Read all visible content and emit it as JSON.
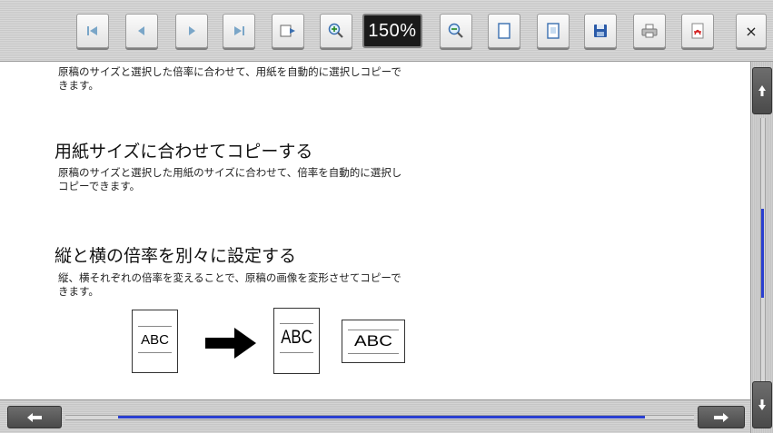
{
  "toolbar": {
    "buttons": [
      {
        "name": "first-page-button",
        "icon": "first-page-icon"
      },
      {
        "name": "previous-page-button",
        "icon": "previous-page-icon"
      },
      {
        "name": "next-page-button",
        "icon": "next-page-icon"
      },
      {
        "name": "last-page-button",
        "icon": "last-page-icon"
      },
      {
        "name": "page-jump-button",
        "icon": "page-arrow-icon"
      },
      {
        "name": "zoom-in-button",
        "icon": "zoom-in-icon"
      },
      {
        "name": "zoom-out-button",
        "icon": "zoom-out-icon"
      },
      {
        "name": "fit-page-button",
        "icon": "page-icon"
      },
      {
        "name": "page-view-button",
        "icon": "document-icon"
      },
      {
        "name": "save-button",
        "icon": "floppy-disk-icon"
      },
      {
        "name": "print-button",
        "icon": "printer-icon"
      },
      {
        "name": "pdf-button",
        "icon": "pdf-icon"
      }
    ],
    "zoom_level": "150%",
    "close_label": "×"
  },
  "content": {
    "intro_text_line1": "原稿のサイズと選択した倍率に合わせて、用紙を自動的に選択しコピーで",
    "intro_text_line2": "きます。",
    "section1": {
      "heading": "用紙サイズに合わせてコピーする",
      "text_line1": "原稿のサイズと選択した用紙のサイズに合わせて、倍率を自動的に選択し",
      "text_line2": "コピーできます。"
    },
    "section2": {
      "heading": "縦と横の倍率を別々に設定する",
      "text_line1": "縦、横それぞれの倍率を変えることで、原稿の画像を変形させてコピーで",
      "text_line2": "きます。"
    },
    "illustration": {
      "original_label": "ABC",
      "tall_label": "ABC",
      "wide_label": "ABC"
    }
  },
  "scrollbars": {
    "vertical": {
      "thumb_color": "#2a3fd0"
    },
    "horizontal": {
      "thumb_color": "#2a3fd0"
    }
  },
  "colors": {
    "accent": "#2a3fd0",
    "zoom_display_bg": "#1a1a1a"
  }
}
